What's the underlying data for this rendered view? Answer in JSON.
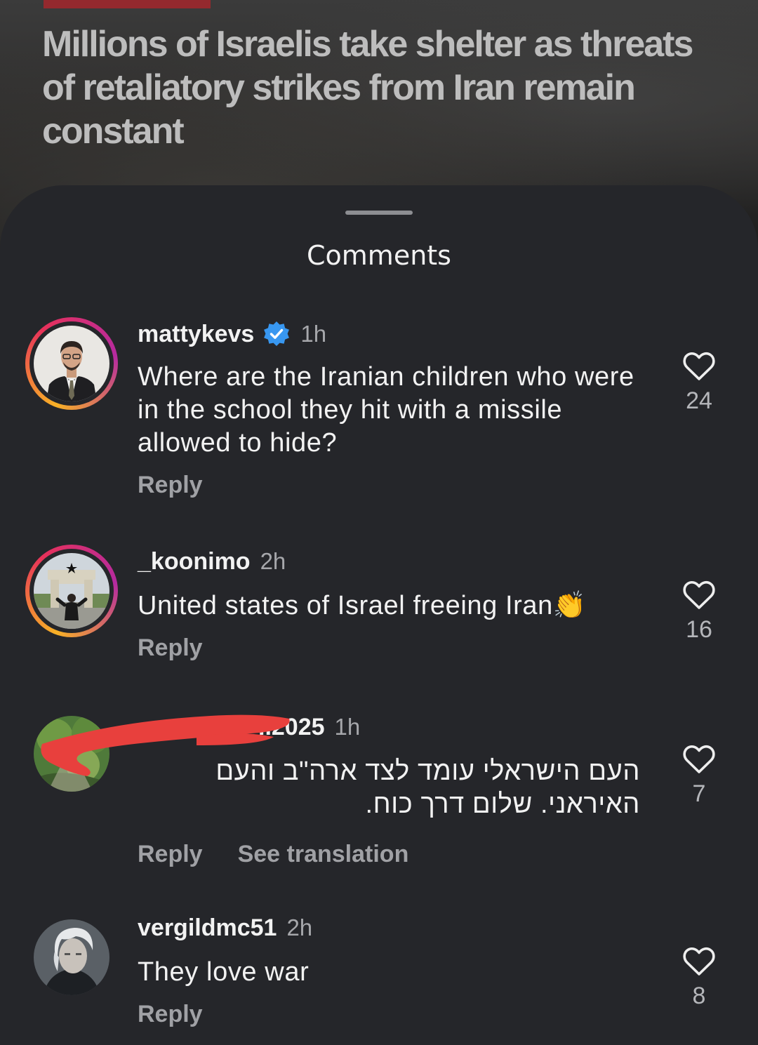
{
  "article": {
    "headline": "Millions of Israelis take shelter as threats of retaliatory strikes from Iran remain constant"
  },
  "sheet": {
    "title": "Comments"
  },
  "comments": [
    {
      "username": "mattykevs",
      "verified": true,
      "time": "1h",
      "text": "Where are the Iranian children who were in the school they hit with a missile allowed to hide?",
      "reply_label": "Reply",
      "likes": "24"
    },
    {
      "username": "_koonimo",
      "verified": false,
      "time": "2h",
      "text": "United states of Israel freeing Iran👏",
      "reply_label": "Reply",
      "likes": "16"
    },
    {
      "username": "..2025",
      "verified": false,
      "time": "1h",
      "text": "העם הישראלי עומד לצד ארה\"ב והעם האיראני. שלום דרך כוח.",
      "reply_label": "Reply",
      "translation_label": "See translation",
      "likes": "7"
    },
    {
      "username": "vergildmc51",
      "verified": false,
      "time": "2h",
      "text": "They love war",
      "reply_label": "Reply",
      "likes": "8"
    }
  ],
  "colors": {
    "sheet_bg": "#25262a",
    "verified_blue": "#3897f0",
    "redaction_red": "#e8403d"
  }
}
